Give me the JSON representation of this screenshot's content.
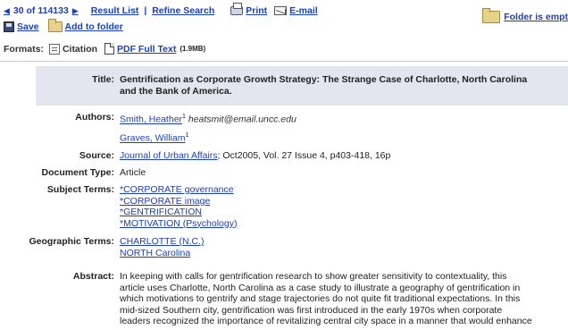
{
  "nav": {
    "prev_arrow": "◀",
    "counter": "30 of 114133",
    "next_arrow": "▶",
    "result_list": "Result List",
    "separator": "|",
    "refine_search": "Refine Search",
    "print": "Print",
    "email": "E-mail",
    "save": "Save",
    "add_to_folder": "Add to folder",
    "folder_text": "Folder is empt"
  },
  "formats": {
    "label": "Formats:",
    "citation": "Citation",
    "pdf": "PDF Full Text",
    "pdf_size": "(1.9MB)"
  },
  "record": {
    "title_label": "Title:",
    "title_line1": "Gentrification as Corporate Growth Strategy: The Strange Case of Charlotte, North Carolina",
    "title_line2": "and the Bank of America.",
    "authors_label": "Authors:",
    "author1": "Smith, Heather",
    "author1_sup": "1",
    "author1_email": "heatsmit@email.uncc.edu",
    "author2": "Graves, William",
    "author2_sup": "1",
    "source_label": "Source:",
    "source_link": "Journal of Urban Affairs",
    "source_rest": "; Oct2005, Vol. 27 Issue 4, p403-418, 16p",
    "doctype_label": "Document Type:",
    "doctype": "Article",
    "subject_label": "Subject Terms:",
    "subjects": [
      "*CORPORATE governance",
      "*CORPORATE image",
      "*GENTRIFICATION",
      "*MOTIVATION (Psychology)"
    ],
    "geo_label": "Geographic Terms:",
    "geo": [
      "CHARLOTTE (N.C.)",
      "NORTH Carolina"
    ],
    "abstract_label": "Abstract:",
    "abstract_lines": [
      "In keeping with calls for gentrification research to show greater sensitivity to contextuality, this",
      "article uses Charlotte, North Carolina as a case study to illustrate a geography of gentrification in",
      "which motivations to gentrify and stage trajectories do not quite fit traditional expectations. In this",
      "mid-sized Southern city, gentrification was first introduced in the early 1970s when corporate",
      "leaders recognized the importance of revitalizing central city space in a manner that would enhance"
    ]
  }
}
